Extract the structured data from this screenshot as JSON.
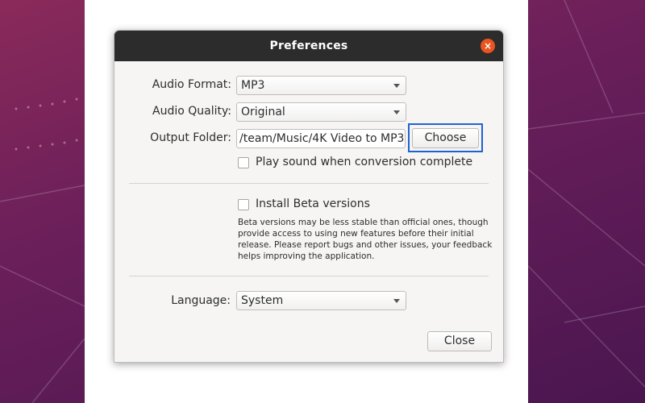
{
  "dialog": {
    "title": "Preferences",
    "close_glyph": "×"
  },
  "form": {
    "audio_format": {
      "label": "Audio Format:",
      "value": "MP3"
    },
    "audio_quality": {
      "label": "Audio Quality:",
      "value": "Original"
    },
    "output_folder": {
      "label": "Output Folder:",
      "value": "/team/Music/4K Video to MP3",
      "button": "Choose"
    },
    "play_sound": {
      "label": "Play sound when conversion complete",
      "checked": false
    },
    "beta": {
      "label": "Install Beta versions",
      "checked": false,
      "note_lines": [
        "Beta versions may be less stable than official ones, though",
        "provide access to using new features before their initial",
        "release. Please report bugs and other issues, your feedback",
        "helps improving the application."
      ]
    },
    "language": {
      "label": "Language:",
      "value": "System"
    }
  },
  "footer": {
    "close_label": "Close"
  },
  "colors": {
    "accent": "#e95420",
    "focus": "#1f63d2",
    "titlebar": "#2c2c2c"
  },
  "icons": {
    "combo_arrow": "chevron-down-icon",
    "close": "close-icon"
  }
}
